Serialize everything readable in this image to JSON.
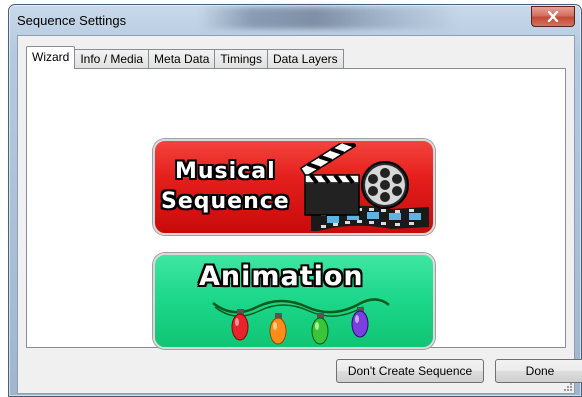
{
  "window": {
    "title": "Sequence Settings",
    "close_label": "x"
  },
  "tabs": [
    {
      "label": "Wizard",
      "active": true
    },
    {
      "label": "Info / Media",
      "active": false
    },
    {
      "label": "Meta Data",
      "active": false
    },
    {
      "label": "Timings",
      "active": false
    },
    {
      "label": "Data Layers",
      "active": false
    }
  ],
  "wizard": {
    "musical_button": {
      "line1": "Musical",
      "line2": "Sequence",
      "icon": "clapperboard-film-reel-icon",
      "color": "#e41f1c"
    },
    "animation_button": {
      "label": "Animation",
      "icon": "christmas-lights-icon",
      "color": "#1ed88c"
    }
  },
  "footer": {
    "dont_create_label": "Don't Create Sequence",
    "done_label": "Done"
  },
  "colors": {
    "light_red": "#e8232b",
    "light_orange": "#ff8c1a",
    "light_green": "#3ac43a",
    "light_purple": "#7a3fe0"
  }
}
